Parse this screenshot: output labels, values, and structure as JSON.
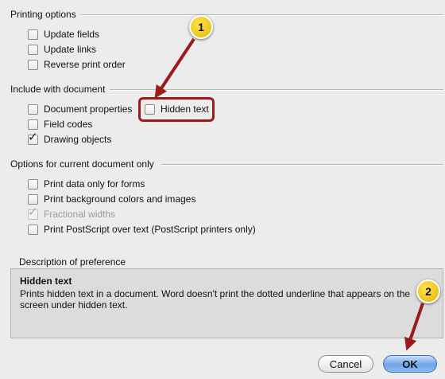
{
  "sections": {
    "printing_options": {
      "title": "Printing options",
      "items": [
        {
          "label": "Update fields",
          "checked": false,
          "disabled": false
        },
        {
          "label": "Update links",
          "checked": false,
          "disabled": false
        },
        {
          "label": "Reverse print order",
          "checked": false,
          "disabled": false
        }
      ]
    },
    "include_with_document": {
      "title": "Include with document",
      "items": [
        {
          "label": "Document properties",
          "checked": false,
          "disabled": false
        },
        {
          "label": "Hidden text",
          "checked": false,
          "disabled": false
        },
        {
          "label": "Field codes",
          "checked": false,
          "disabled": false
        },
        {
          "label": "Drawing objects",
          "checked": true,
          "disabled": false
        }
      ]
    },
    "current_document": {
      "title": "Options for current document only",
      "items": [
        {
          "label": "Print data only for forms",
          "checked": false,
          "disabled": false
        },
        {
          "label": "Print background colors and images",
          "checked": false,
          "disabled": false
        },
        {
          "label": "Fractional widths",
          "checked": true,
          "disabled": true
        },
        {
          "label": "Print PostScript over text (PostScript printers only)",
          "checked": false,
          "disabled": false
        }
      ]
    }
  },
  "description": {
    "section_title": "Description of preference",
    "title": "Hidden text",
    "text": "Prints hidden text in a document. Word doesn't print the dotted underline that appears on the screen under hidden text."
  },
  "buttons": {
    "cancel": "Cancel",
    "ok": "OK"
  },
  "annotations": {
    "badge1": "1",
    "badge2": "2",
    "color": "#9b1b1b"
  },
  "checkmark_glyph": "✓"
}
